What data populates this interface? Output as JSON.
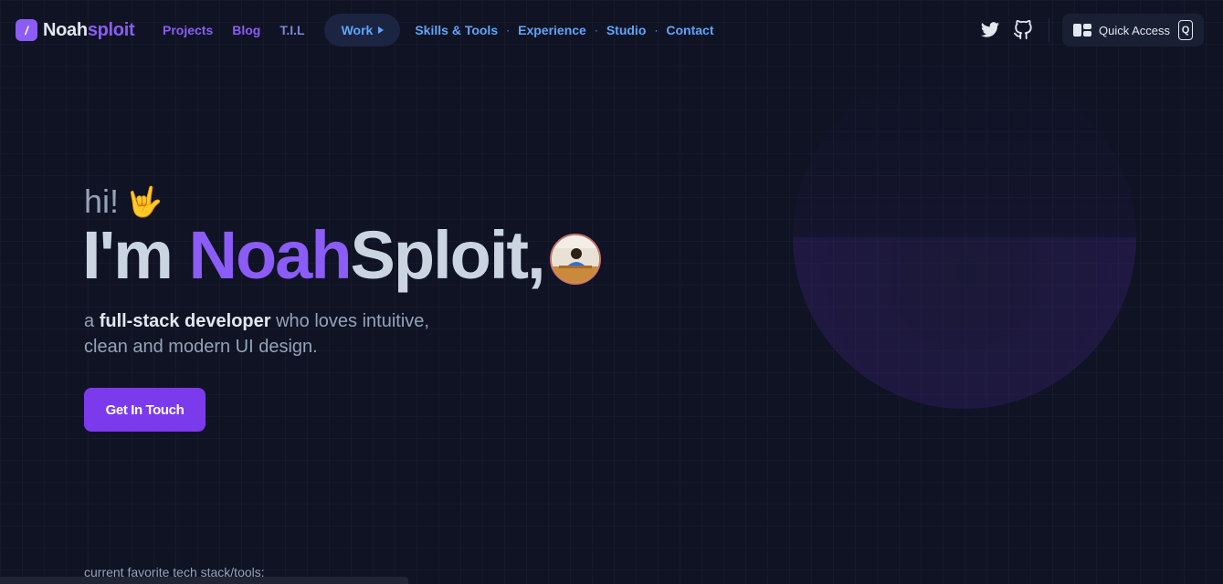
{
  "brand": {
    "name_part1": "Noah",
    "name_part2": "sploit",
    "badge_char": "/"
  },
  "nav": {
    "links": [
      "Projects",
      "Blog",
      "T.I.L"
    ],
    "work_label": "Work",
    "work_links": [
      "Skills & Tools",
      "Experience",
      "Studio",
      "Contact"
    ]
  },
  "header_actions": {
    "twitter_icon": "twitter-icon",
    "github_icon": "github-icon",
    "quick_access_label": "Quick Access",
    "quick_access_key": "Q"
  },
  "hero": {
    "greeting": "hi!",
    "wave_emoji": "🤟",
    "headline_prefix": "I'm ",
    "headline_name": "Noah",
    "headline_suffix": "Sploit,",
    "subtitle_prefix": "a ",
    "subtitle_strong": "full-stack developer",
    "subtitle_rest": " who loves intuitive, clean and modern UI design.",
    "cta_label": "Get In Touch"
  },
  "tech_stack_label": "current favorite tech stack/tools:",
  "colors": {
    "background": "#0f1324",
    "accent_violet": "#8b5cf6",
    "accent_blue": "#60a5fa",
    "cta": "#7c3aed"
  }
}
